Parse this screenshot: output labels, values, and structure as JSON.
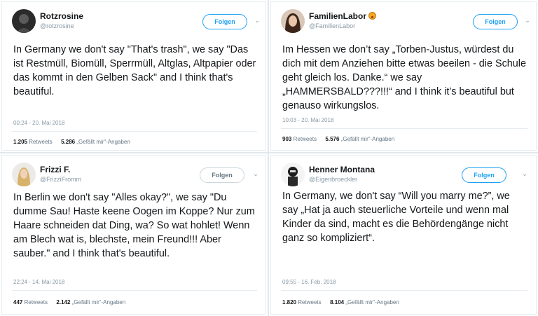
{
  "tweets": [
    {
      "name": "Rotzrosine",
      "handle": "@rotzrosine",
      "follow_label": "Folgen",
      "text": "In Germany we don't say \"That's trash\", we say \"Das ist Restmüll, Biomüll, Sperrmüll, Altglas, Altpapier oder das kommt in den Gelben Sack\" and I think that's beautiful.",
      "timestamp": "00:24 - 20. Mai 2018",
      "retweets": "1.205",
      "retweets_label": "Retweets",
      "likes": "5.286",
      "likes_label": "„Gefällt mir“-Angaben"
    },
    {
      "name": "FamilienLabor",
      "handle": "@FamilienLabor",
      "follow_label": "Folgen",
      "text": "Im Hessen we don’t say „Torben-Justus, würdest du dich mit dem Anziehen bitte etwas beeilen - die Schule geht gleich los. Danke.“ we say „HAMMERSBALD???!!!“ and I think it’s beautiful but genauso wirkungslos.",
      "timestamp": "10:03 - 20. Mai 2018",
      "retweets": "903",
      "retweets_label": "Retweets",
      "likes": "5.576",
      "likes_label": "„Gefällt mir“-Angaben"
    },
    {
      "name": "Frizzi F.",
      "handle": "@FrizziFromm",
      "follow_label": "Folgen",
      "text": "In Berlin we don't say \"Alles okay?\", we say \"Du dumme Sau! Haste keene Oogen im Koppe? Nur zum Haare schneiden dat Ding, wa? So wat hohlet! Wenn am Blech wat is, blechste, mein Freund!!! Aber sauber.\" and I think that's beautiful.",
      "timestamp": "22:24 - 14. Mai 2018",
      "retweets": "447",
      "retweets_label": "Retweets",
      "likes": "2.142",
      "likes_label": "„Gefällt mir“-Angaben"
    },
    {
      "name": "Henner Montana",
      "handle": "@Eigenbroeckler",
      "follow_label": "Folgen",
      "text": "In Germany, we don't say “Will you marry me?”, we say „Hat ja auch steuerliche Vorteile und wenn mal Kinder da sind, macht es die Behördengänge nicht ganz so kompliziert“.",
      "timestamp": "09:55 - 16. Feb. 2018",
      "retweets": "1.820",
      "retweets_label": "Retweets",
      "likes": "8.104",
      "likes_label": "„Gefällt mir“-Angaben"
    }
  ],
  "colors": {
    "accent": "#1da1f2",
    "text": "#14171a",
    "muted": "#8899a6",
    "border": "#e6ecf0"
  },
  "icons": [
    "avatar",
    "emoji-icon",
    "chevron-down-icon"
  ]
}
